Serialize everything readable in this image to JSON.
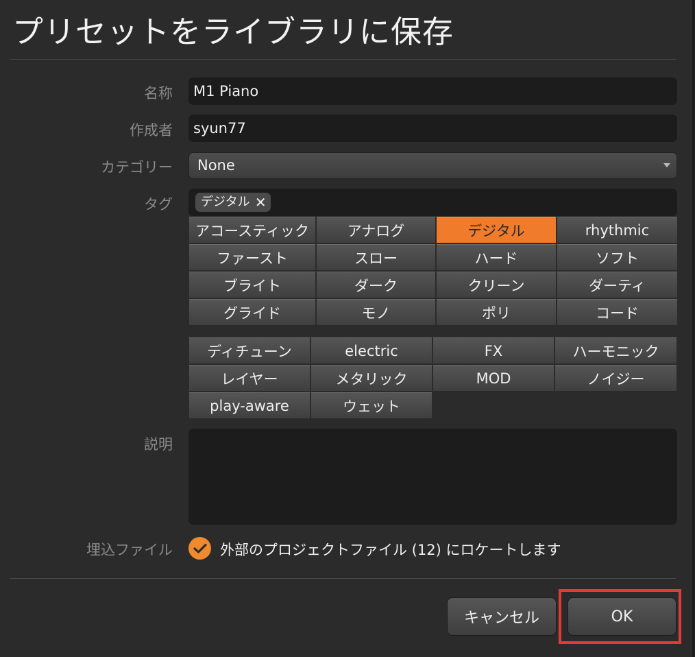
{
  "dialog": {
    "title": "プリセットをライブラリに保存"
  },
  "form": {
    "name_label": "名称",
    "name_value": "M1 Piano",
    "author_label": "作成者",
    "author_value": "syun77",
    "category_label": "カテゴリー",
    "category_value": "None",
    "tags_label": "タグ",
    "selected_tag": "デジタル",
    "description_label": "説明",
    "description_value": "",
    "embed_label": "埋込ファイル",
    "embed_text": "外部のプロジェクトファイル (12) にロケートします",
    "embed_checked": true
  },
  "tag_grid_1": [
    {
      "label": "アコースティック",
      "active": false
    },
    {
      "label": "アナログ",
      "active": false
    },
    {
      "label": "デジタル",
      "active": true
    },
    {
      "label": "rhythmic",
      "active": false
    },
    {
      "label": "ファースト",
      "active": false
    },
    {
      "label": "スロー",
      "active": false
    },
    {
      "label": "ハード",
      "active": false
    },
    {
      "label": "ソフト",
      "active": false
    },
    {
      "label": "ブライト",
      "active": false
    },
    {
      "label": "ダーク",
      "active": false
    },
    {
      "label": "クリーン",
      "active": false
    },
    {
      "label": "ダーティ",
      "active": false
    },
    {
      "label": "グライド",
      "active": false
    },
    {
      "label": "モノ",
      "active": false
    },
    {
      "label": "ポリ",
      "active": false
    },
    {
      "label": "コード",
      "active": false
    }
  ],
  "tag_grid_2": [
    {
      "label": "ディチューン",
      "active": false
    },
    {
      "label": "electric",
      "active": false
    },
    {
      "label": "FX",
      "active": false
    },
    {
      "label": "ハーモニック",
      "active": false
    },
    {
      "label": "レイヤー",
      "active": false
    },
    {
      "label": "メタリック",
      "active": false
    },
    {
      "label": "MOD",
      "active": false
    },
    {
      "label": "ノイジー",
      "active": false
    },
    {
      "label": "play-aware",
      "active": false
    },
    {
      "label": "ウェット",
      "active": false
    }
  ],
  "buttons": {
    "cancel_label": "キャンセル",
    "ok_label": "OK"
  },
  "colors": {
    "accent": "#f07b2a",
    "highlight": "#e23a3a"
  },
  "icons": {
    "chip_remove": "close-icon",
    "dropdown": "chevron-down-icon",
    "checkbox": "checkmark-icon"
  }
}
